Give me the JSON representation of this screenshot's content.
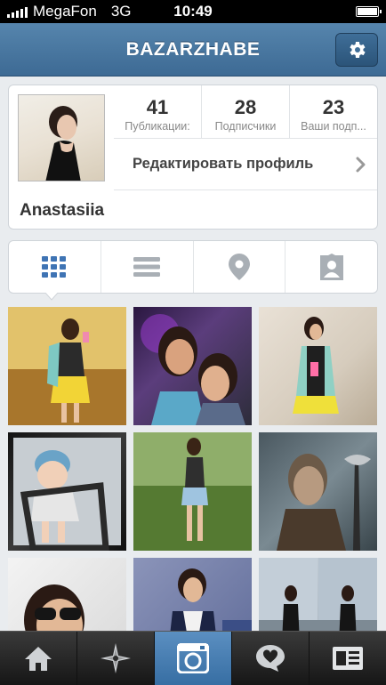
{
  "status_bar": {
    "carrier": "MegaFon",
    "network": "3G",
    "time": "10:49"
  },
  "header": {
    "title": "BAZARZHABE",
    "settings_icon": "gear-icon"
  },
  "profile": {
    "name": "Anastasiia",
    "stats": [
      {
        "value": "41",
        "label": "Публикации:"
      },
      {
        "value": "28",
        "label": "Подписчики"
      },
      {
        "value": "23",
        "label": "Ваши подп..."
      }
    ],
    "edit_button_label": "Редактировать профиль"
  },
  "view_tabs": [
    {
      "icon": "grid-icon",
      "active": true
    },
    {
      "icon": "list-icon",
      "active": false
    },
    {
      "icon": "location-pin-icon",
      "active": false
    },
    {
      "icon": "tagged-photos-icon",
      "active": false
    }
  ],
  "photos": [
    "photo-1",
    "photo-2",
    "photo-3",
    "photo-4",
    "photo-5",
    "photo-6",
    "photo-7",
    "photo-8",
    "photo-9"
  ],
  "bottom_nav": [
    {
      "icon": "home-icon",
      "active": false
    },
    {
      "icon": "explore-icon",
      "active": false
    },
    {
      "icon": "camera-icon",
      "active": true
    },
    {
      "icon": "activity-icon",
      "active": false
    },
    {
      "icon": "profile-icon",
      "active": false
    }
  ],
  "colors": {
    "navbar": "#4a78a2",
    "tab_active": "#3f74b4",
    "tab_inactive": "#a9afb5",
    "bottom_active": "#4a80b5"
  }
}
